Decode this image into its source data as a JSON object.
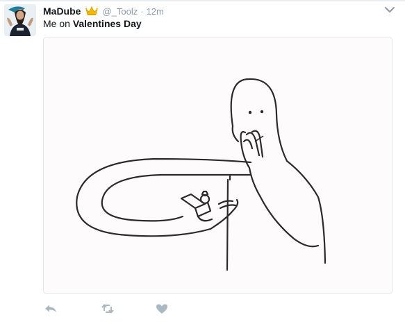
{
  "tweet": {
    "display_name": "MaDube",
    "badge_icon": "crown-emoji-icon",
    "handle": "@_Toolz",
    "separator": "·",
    "time": "12m",
    "text_prefix": "Me on ",
    "text_bold": "Valentines Day"
  },
  "actions": {
    "reply_icon": "reply-icon",
    "retweet_icon": "retweet-icon",
    "like_icon": "heart-icon"
  },
  "colors": {
    "text": "#14171a",
    "muted": "#8899a6",
    "border": "#e1e8ed",
    "icon": "#aab8c2"
  }
}
